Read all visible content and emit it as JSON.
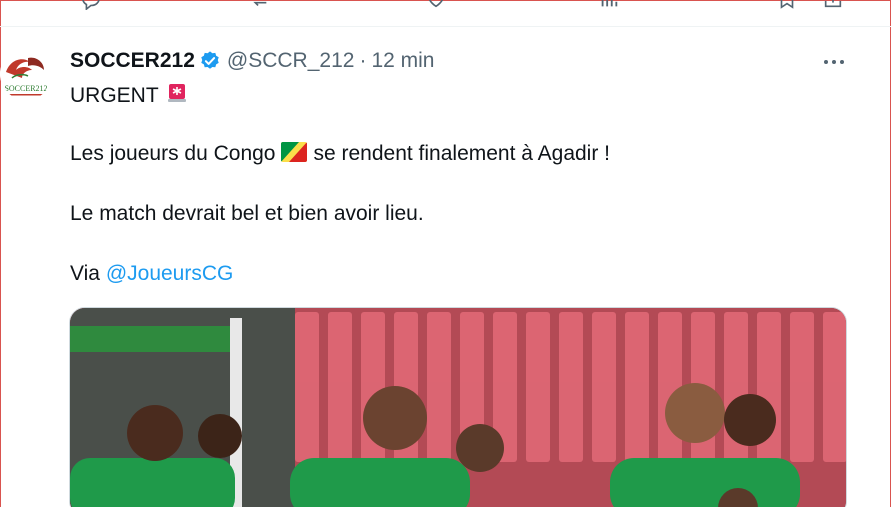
{
  "tweet": {
    "display_name": "SOCCER212",
    "handle": "@SCCR_212",
    "separator": "·",
    "time": "12 min",
    "line1": "URGENT",
    "line2a": "Les joueurs du Congo",
    "line2b": "se rendent finalement à Agadir !",
    "line3": "Le match devrait bel et bien avoir lieu.",
    "line4_prefix": "Via",
    "mention": "@JoueursCG",
    "avatar_text": "SOCCER212"
  },
  "icons": [
    "verified-icon",
    "siren-icon",
    "congo-flag-icon",
    "more-icon",
    "reply-icon",
    "retweet-icon",
    "like-icon",
    "views-icon",
    "bookmark-icon",
    "share-icon"
  ],
  "colors": {
    "accent": "#1d9bf0",
    "text": "#0f1419",
    "muted": "#536471",
    "frame": "#d9534f"
  }
}
